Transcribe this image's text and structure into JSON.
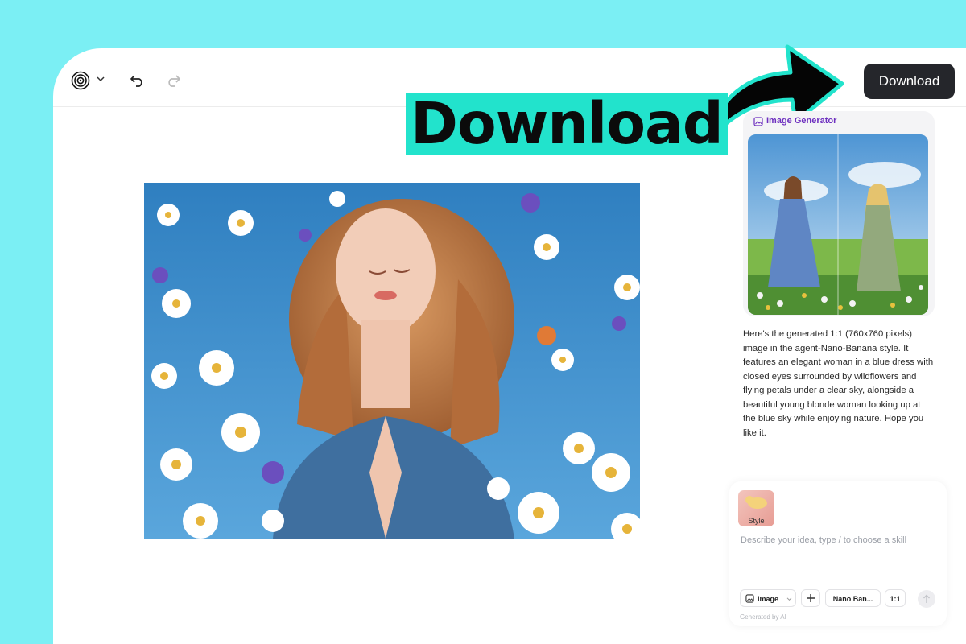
{
  "toolbar": {
    "logo_icon": "spiral-logo-icon",
    "logo_menu_icon": "chevron-down-icon",
    "undo_icon": "undo-icon",
    "redo_icon": "redo-icon",
    "download_label": "Download"
  },
  "overlay": {
    "title": "Download",
    "title_bg": "#22e3cc",
    "arrow_icon": "curved-arrow-icon"
  },
  "canvas": {
    "image_subject": "woman-with-daisies-under-blue-sky"
  },
  "chat": {
    "tool_label": "Image Generator",
    "tool_icon": "image-icon",
    "result_image": "two-women-in-meadow",
    "message": "Here's the generated 1:1 (760x760 pixels) image in the agent-Nano-Banana style. It features an elegant woman in a blue dress with closed eyes surrounded by wildflowers and flying petals under a clear sky, alongside a beautiful young blonde woman looking up at the blue sky while enjoying nature. Hope you like it."
  },
  "composer": {
    "style_label": "Style",
    "placeholder": "Describe your idea, type / to choose a skill",
    "mode_label": "Image",
    "add_icon": "plus-icon",
    "model_label": "Nano Ban...",
    "ratio_label": "1:1",
    "send_icon": "arrow-up-icon",
    "footer_note": "Generated by AI"
  },
  "colors": {
    "background": "#7beff4",
    "download_button": "#25262b",
    "accent_purple": "#6d2fbf"
  }
}
